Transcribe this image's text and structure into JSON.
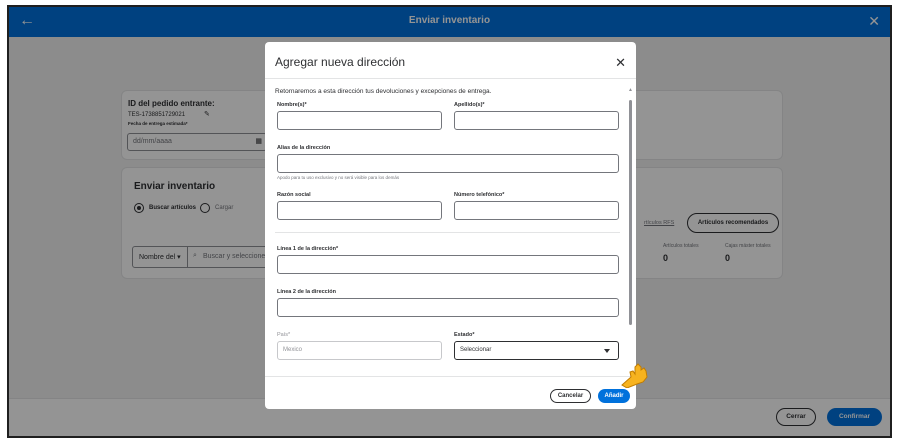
{
  "topbar": {
    "title": "Enviar inventario"
  },
  "order": {
    "title": "ID del pedido entrante:",
    "id": "TES-1738851729021",
    "date_label": "Fecha de entrega estimada*",
    "date_placeholder": "dd/mm/aaaa"
  },
  "send": {
    "title": "Enviar inventario",
    "radio_search": "Buscar artículos",
    "radio_upload": "Cargar",
    "filter_select": "Nombre del",
    "search_placeholder": "Buscar y seleccione",
    "link_partial": "rtículos RFS",
    "recommended_button": "Artículos recomendados",
    "totals_items_label": "Artículos totales",
    "totals_items_value": "0",
    "totals_boxes_label": "Cajas máster totales",
    "totals_boxes_value": "0"
  },
  "footer": {
    "close": "Cerrar",
    "confirm": "Confirmar"
  },
  "modal": {
    "title": "Agregar nueva dirección",
    "info": "Retornaremos a esta dirección tus devoluciones y excepciones de entrega.",
    "first_name_label": "Nombre(s)*",
    "last_name_label": "Apellido(s)*",
    "alias_label": "Alias de la dirección",
    "alias_helper": "Apodo para tu uso exclusivo y no será visible para los demás",
    "company_label": "Razón social",
    "phone_label": "Número telefónico*",
    "line1_label": "Línea 1 de la dirección*",
    "line2_label": "Línea 2 de la dirección",
    "country_label": "País*",
    "country_value": "Mexico",
    "state_label": "Estado*",
    "state_value": "Seleccionar",
    "cancel": "Cancelar",
    "add": "Añadir"
  },
  "colors": {
    "brand": "#0071dc",
    "accent_hand": "#f7b31f"
  }
}
